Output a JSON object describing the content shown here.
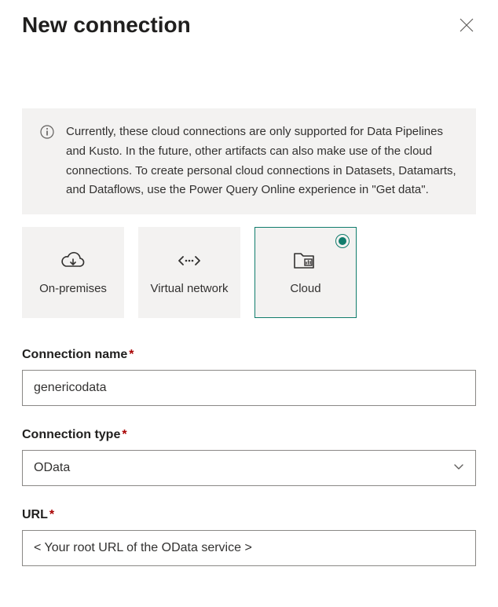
{
  "header": {
    "title": "New connection"
  },
  "banner": {
    "text": "Currently, these cloud connections are only supported for Data Pipelines and Kusto. In the future, other artifacts can also make use of the cloud connections. To create personal cloud connections in Datasets, Datamarts, and Dataflows, use the Power Query Online experience in \"Get data\"."
  },
  "tiles": {
    "onprem": {
      "label": "On-premises"
    },
    "vnet": {
      "label": "Virtual network"
    },
    "cloud": {
      "label": "Cloud",
      "selected": true
    }
  },
  "form": {
    "connection_name": {
      "label": "Connection name",
      "required": "*",
      "value": "genericodata"
    },
    "connection_type": {
      "label": "Connection type",
      "required": "*",
      "value": "OData"
    },
    "url": {
      "label": "URL",
      "required": "*",
      "value": "< Your root URL of the OData service >"
    }
  }
}
